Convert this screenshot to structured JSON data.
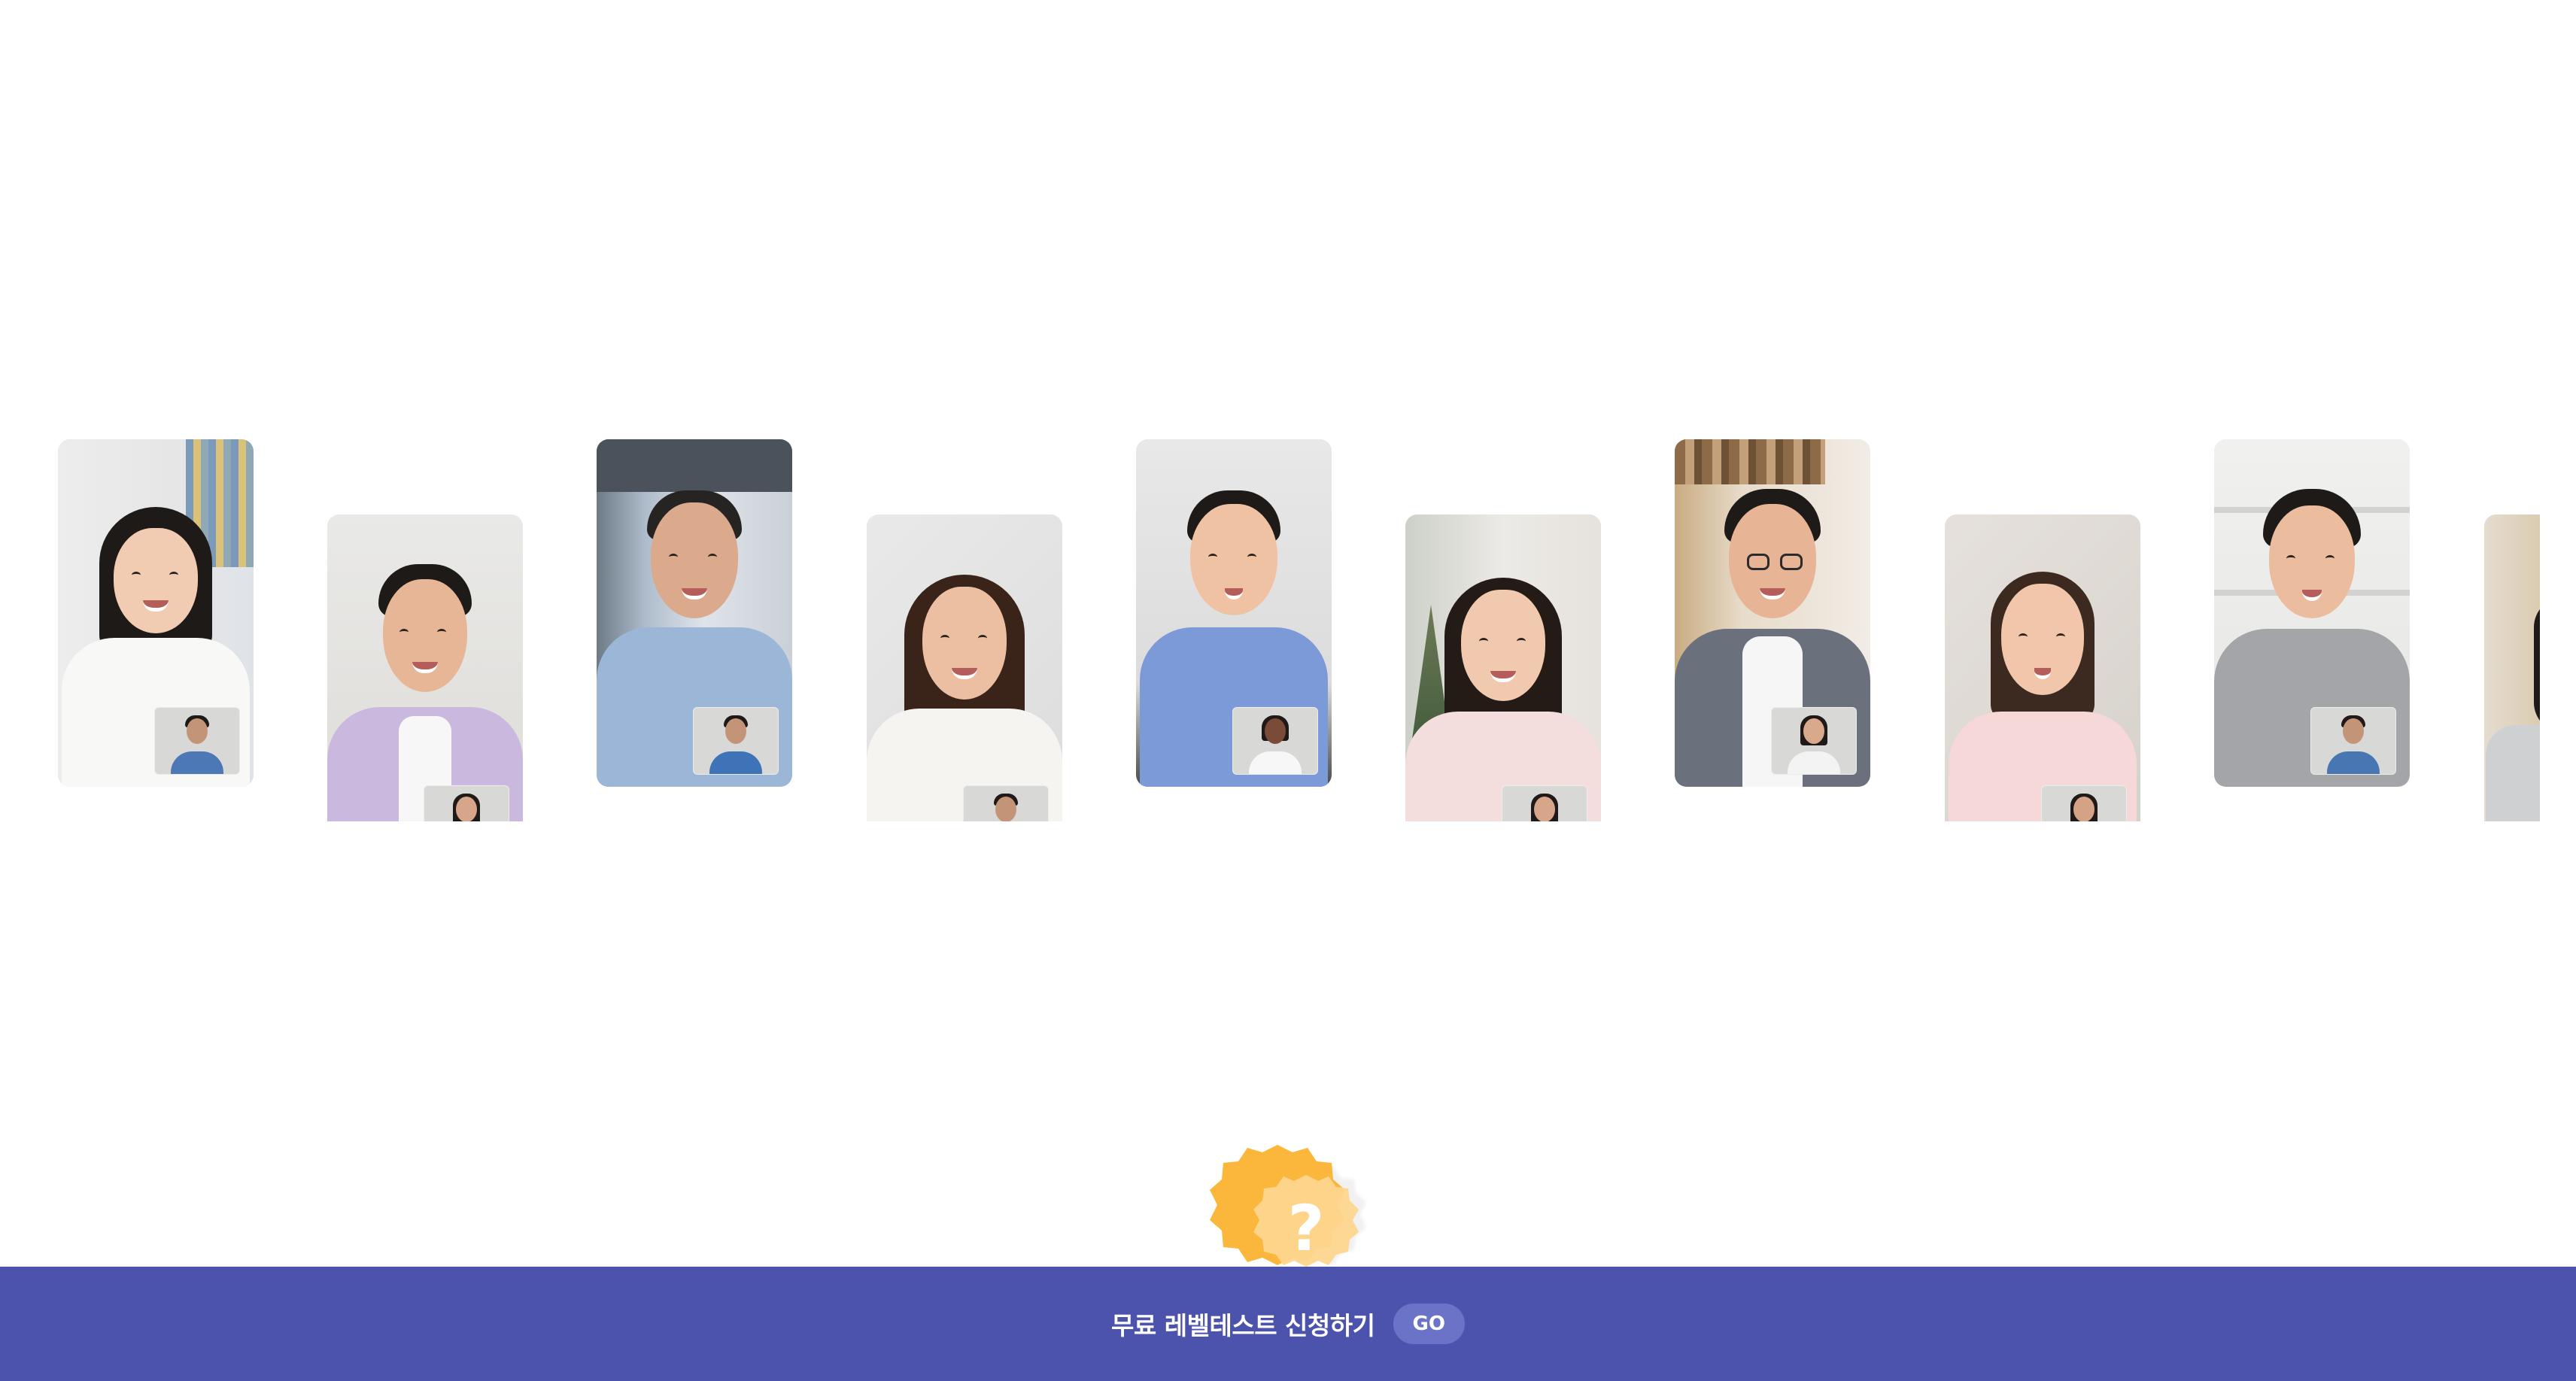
{
  "cta": {
    "text": "무료 레벨테스트 신청하기",
    "go_label": "GO",
    "bar_color": "#4c53ad",
    "go_color": "#6b73c8"
  },
  "badge": {
    "symbol": "?",
    "colors": [
      "#fbb63c",
      "#fdd48a",
      "#f3f3f3"
    ]
  },
  "carousel": {
    "cards": [
      {
        "subject": "girl-white-tshirt"
      },
      {
        "subject": "man-lavender-shirt"
      },
      {
        "subject": "older-man-blue-shirt"
      },
      {
        "subject": "woman-white-sweater"
      },
      {
        "subject": "boy-blue-tshirt"
      },
      {
        "subject": "woman-light-pink-top"
      },
      {
        "subject": "man-glasses-grey-shirt"
      },
      {
        "subject": "girl-pink-tshirt"
      },
      {
        "subject": "teen-grey-sweatshirt"
      },
      {
        "subject": "partial-next-card"
      }
    ]
  }
}
